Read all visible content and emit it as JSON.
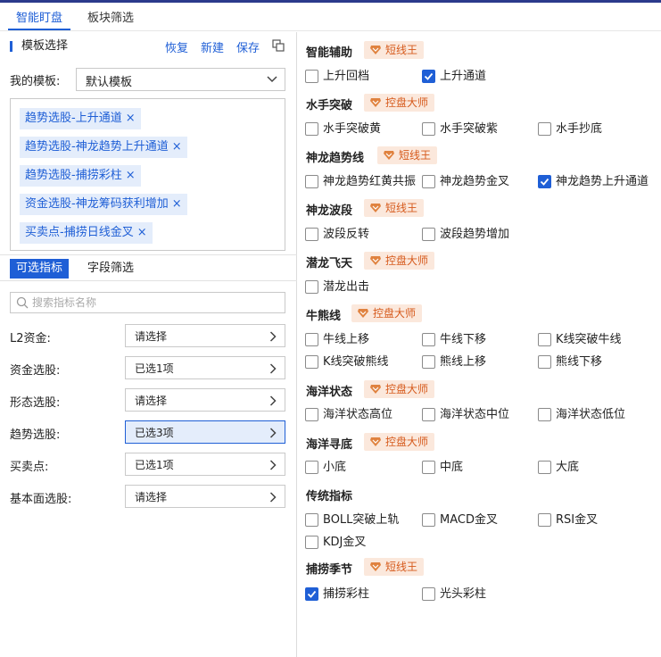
{
  "tabs": [
    "智能盯盘",
    "板块筛选"
  ],
  "template_panel": {
    "title": "模板选择",
    "actions": [
      "恢复",
      "新建",
      "保存"
    ],
    "my_template_label": "我的模板:",
    "my_template_value": "默认模板",
    "tags": [
      "趋势选股-上升通道",
      "趋势选股-神龙趋势上升通道",
      "趋势选股-捕捞彩柱",
      "资金选股-神龙筹码获利增加",
      "买卖点-捕捞日线金叉"
    ]
  },
  "sub_tabs": [
    "可选指标",
    "字段筛选"
  ],
  "search": {
    "placeholder": "搜索指标名称",
    "value": ""
  },
  "filters": [
    {
      "label": "L2资金:",
      "value": "请选择"
    },
    {
      "label": "资金选股:",
      "value": "已选1项"
    },
    {
      "label": "形态选股:",
      "value": "请选择"
    },
    {
      "label": "趋势选股:",
      "value": "已选3项"
    },
    {
      "label": "买卖点:",
      "value": "已选1项"
    },
    {
      "label": "基本面选股:",
      "value": "请选择"
    }
  ],
  "sections": [
    {
      "title": "智能辅助",
      "badge": "短线王",
      "items": [
        {
          "label": "上升回档",
          "checked": false
        },
        {
          "label": "上升通道",
          "checked": true
        }
      ]
    },
    {
      "title": "水手突破",
      "badge": "控盘大师",
      "items": [
        {
          "label": "水手突破黄",
          "checked": false
        },
        {
          "label": "水手突破紫",
          "checked": false
        },
        {
          "label": "水手抄底",
          "checked": false
        }
      ]
    },
    {
      "title": "神龙趋势线",
      "badge": "短线王",
      "items": [
        {
          "label": "神龙趋势红黄共振",
          "checked": false
        },
        {
          "label": "神龙趋势金叉",
          "checked": false
        },
        {
          "label": "神龙趋势上升通道",
          "checked": true
        }
      ]
    },
    {
      "title": "神龙波段",
      "badge": "短线王",
      "items": [
        {
          "label": "波段反转",
          "checked": false
        },
        {
          "label": "波段趋势增加",
          "checked": false
        }
      ]
    },
    {
      "title": "潜龙飞天",
      "badge": "控盘大师",
      "items": [
        {
          "label": "潜龙出击",
          "checked": false
        }
      ]
    },
    {
      "title": "牛熊线",
      "badge": "控盘大师",
      "items": [
        {
          "label": "牛线上移",
          "checked": false
        },
        {
          "label": "牛线下移",
          "checked": false
        },
        {
          "label": "K线突破牛线",
          "checked": false
        },
        {
          "label": "K线突破熊线",
          "checked": false
        },
        {
          "label": "熊线上移",
          "checked": false
        },
        {
          "label": "熊线下移",
          "checked": false
        }
      ]
    },
    {
      "title": "海洋状态",
      "badge": "控盘大师",
      "items": [
        {
          "label": "海洋状态高位",
          "checked": false
        },
        {
          "label": "海洋状态中位",
          "checked": false
        },
        {
          "label": "海洋状态低位",
          "checked": false
        }
      ]
    },
    {
      "title": "海洋寻底",
      "badge": "控盘大师",
      "items": [
        {
          "label": "小底",
          "checked": false
        },
        {
          "label": "中底",
          "checked": false
        },
        {
          "label": "大底",
          "checked": false
        }
      ]
    },
    {
      "title": "传统指标",
      "badge": "",
      "items": [
        {
          "label": "BOLL突破上轨",
          "checked": false
        },
        {
          "label": "MACD金叉",
          "checked": false
        },
        {
          "label": "RSI金叉",
          "checked": false
        },
        {
          "label": "KDJ金叉",
          "checked": false
        }
      ]
    },
    {
      "title": "捕捞季节",
      "badge": "短线王",
      "items": [
        {
          "label": "捕捞彩柱",
          "checked": true
        },
        {
          "label": "光头彩柱",
          "checked": false
        }
      ]
    }
  ],
  "colors": {
    "accent": "#1f5fd6",
    "badge_bg": "#fbe8dc",
    "badge_text": "#d65a1c",
    "tag_bg": "#e4edfb"
  }
}
